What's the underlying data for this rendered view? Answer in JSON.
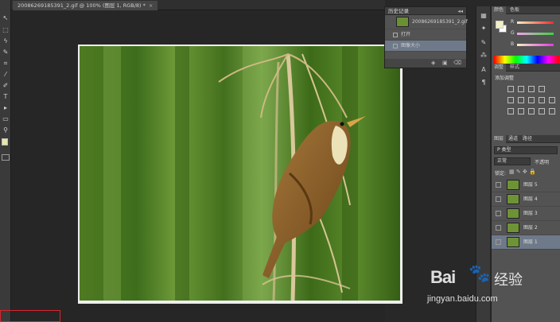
{
  "document_tab": {
    "title": "20086269185391_2.gif @ 100% (图层 1, RGB/8) *",
    "close": "×"
  },
  "history_panel": {
    "title": "历史记录",
    "collapse": "◂◂",
    "snapshot_name": "20086269185391_2.gif",
    "items": [
      {
        "label": "打开"
      },
      {
        "label": "图像大小"
      }
    ]
  },
  "color_panel": {
    "tabs": [
      "颜色",
      "色板"
    ],
    "foreground_color": "#f1efc3",
    "background_color": "#ffffff",
    "sliders": [
      {
        "label": "R",
        "color": "#d23c3c"
      },
      {
        "label": "G",
        "color": "#3cd23c"
      },
      {
        "label": "B",
        "color": "#d23cd2"
      }
    ]
  },
  "adjustments_panel": {
    "tabs": [
      "调整",
      "样式"
    ],
    "title": "添加调整"
  },
  "layers_panel": {
    "tabs": [
      "图层",
      "通道",
      "路径"
    ],
    "filter": "P 类型",
    "blend_mode": "正常",
    "opacity_label": "不透明",
    "lock_label": "锁定:",
    "layers": [
      {
        "name": "图层 5"
      },
      {
        "name": "图层 4"
      },
      {
        "name": "图层 3"
      },
      {
        "name": "图层 2"
      },
      {
        "name": "图层 1"
      }
    ]
  },
  "watermark": {
    "brand_left": "Bai",
    "brand_paw": "🐾",
    "brand_right": "经验",
    "url": "jingyan.baidu.com"
  }
}
